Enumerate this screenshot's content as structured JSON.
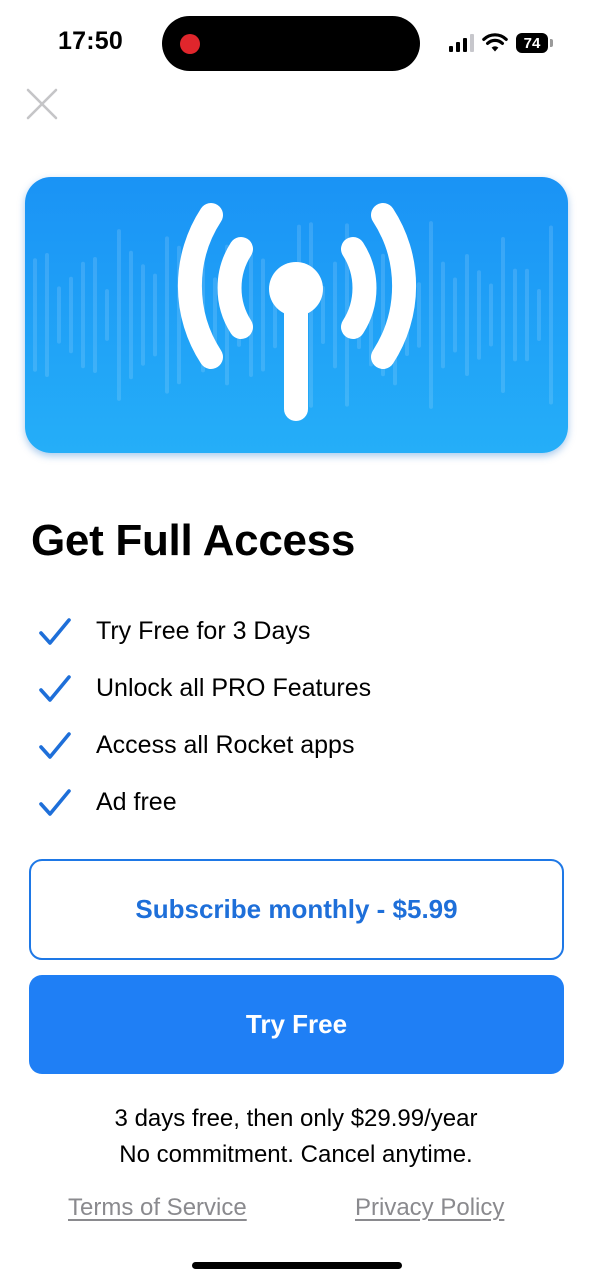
{
  "status_bar": {
    "time": "17:50",
    "battery": "74",
    "icons": [
      "recording-dot",
      "signal-icon",
      "wifi-icon",
      "battery-icon"
    ]
  },
  "header": {
    "close_icon": "close-icon"
  },
  "hero": {
    "icon": "broadcast-antenna-icon",
    "colors": {
      "background_top": "#1a93f5",
      "background_bottom": "#25aef8",
      "icon": "#ffffff"
    }
  },
  "paywall": {
    "title": "Get Full Access",
    "features": [
      {
        "label": "Try Free for 3 Days",
        "icon": "checkmark-icon"
      },
      {
        "label": "Unlock all PRO Features",
        "icon": "checkmark-icon"
      },
      {
        "label": "Access all Rocket apps",
        "icon": "checkmark-icon"
      },
      {
        "label": "Ad free",
        "icon": "checkmark-icon"
      }
    ],
    "subscribe_button": "Subscribe monthly - $5.99",
    "try_free_button": "Try Free",
    "pricing_line1": "3 days free, then only $29.99/year",
    "pricing_line2": "No commitment. Cancel anytime.",
    "links": {
      "terms": "Terms of Service",
      "privacy": "Privacy Policy"
    }
  },
  "colors": {
    "accent": "#1f7ff5",
    "check": "#1e6fd9",
    "link": "#8a8a8e"
  }
}
